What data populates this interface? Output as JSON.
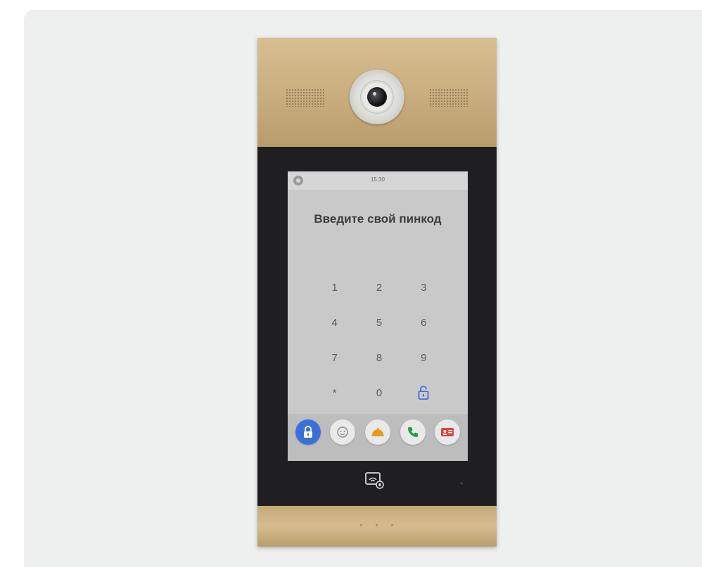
{
  "screen": {
    "time": "15:30",
    "title": "Введите свой пинкод",
    "keypad": [
      {
        "label": "1"
      },
      {
        "label": "2"
      },
      {
        "label": "3"
      },
      {
        "label": "4"
      },
      {
        "label": "5"
      },
      {
        "label": "6"
      },
      {
        "label": "7"
      },
      {
        "label": "8"
      },
      {
        "label": "9"
      },
      {
        "label": "*"
      },
      {
        "label": "0"
      },
      {
        "icon": "unlock-icon"
      }
    ],
    "dock": [
      {
        "icon": "unlock-icon",
        "color": "#3d6fd8"
      },
      {
        "icon": "face-icon",
        "color": "#e9e9ea"
      },
      {
        "icon": "concierge-bell-icon",
        "color": "#e9e9ea"
      },
      {
        "icon": "phone-icon",
        "color": "#e9e9ea"
      },
      {
        "icon": "contacts-icon",
        "color": "#e9e9ea"
      }
    ]
  },
  "colors": {
    "plate": "#c9ad7e",
    "body": "#1f1f21",
    "accent_blue": "#3d6fd8",
    "call_green": "#1f9a4a",
    "bell_orange": "#e89a1a",
    "contacts_red": "#e0443a"
  }
}
